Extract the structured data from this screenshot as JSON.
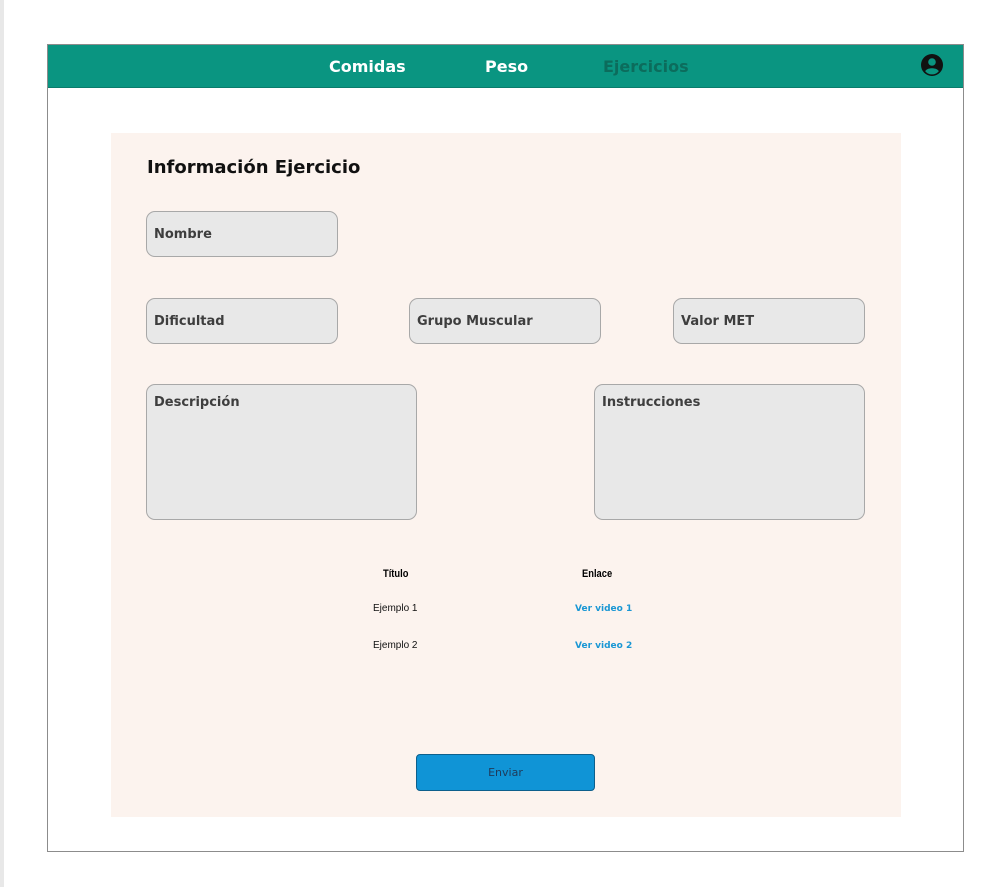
{
  "nav": {
    "items": [
      {
        "label": "Comidas",
        "active": false
      },
      {
        "label": "Peso",
        "active": false
      },
      {
        "label": "Ejercicios",
        "active": true
      }
    ],
    "profile_icon": "user-circle-icon",
    "bar_color": "#0a9581",
    "active_color": "#0c6c5c"
  },
  "form": {
    "title": "Información Ejercicio",
    "fields": {
      "nombre": "Nombre",
      "dificultad": "Dificultad",
      "grupo_muscular": "Grupo Muscular",
      "valor_met": "Valor MET",
      "descripcion": "Descripción",
      "instrucciones": "Instrucciones"
    },
    "background": "#fcf3ee",
    "field_background": "#e8e8e8"
  },
  "table": {
    "headers": [
      "Título",
      "Enlace"
    ],
    "rows": [
      {
        "titulo": "Ejemplo 1",
        "enlace": "Ver video 1"
      },
      {
        "titulo": "Ejemplo 2",
        "enlace": "Ver video 2"
      }
    ],
    "link_color": "#1a97d4"
  },
  "submit": {
    "label": "Enviar",
    "color": "#1094d6"
  }
}
